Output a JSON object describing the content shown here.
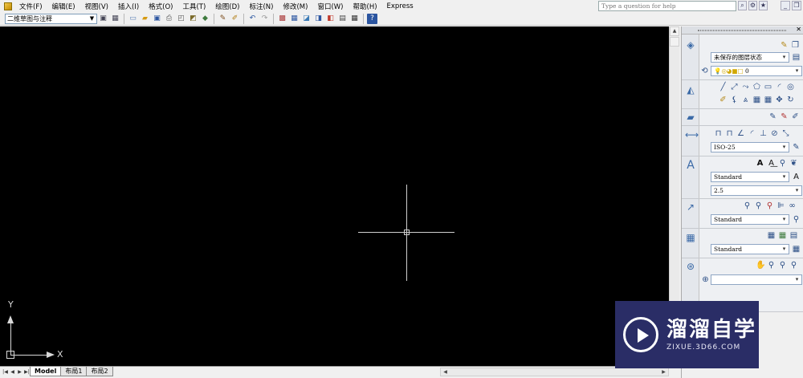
{
  "menubar": {
    "items": [
      "文件(F)",
      "编辑(E)",
      "视图(V)",
      "插入(I)",
      "格式(O)",
      "工具(T)",
      "绘图(D)",
      "标注(N)",
      "修改(M)",
      "窗口(W)",
      "帮助(H)",
      "Express"
    ],
    "help_placeholder": "Type a question for help"
  },
  "toolbar": {
    "workspace_value": "二维草图与注释",
    "icons": [
      "workspace-settings-icon",
      "workspace-icon",
      "new-icon",
      "open-icon",
      "save-icon",
      "print-icon",
      "preview-icon",
      "publish-icon",
      "3d-dwf-icon",
      "cut-icon",
      "match-icon",
      "undo-icon",
      "redo-icon",
      "pan-icon",
      "zoom-icon",
      "properties-icon",
      "design-center-icon",
      "tool-palette-icon",
      "sheet-set-icon",
      "markup-icon",
      "calc-icon",
      "help-icon"
    ]
  },
  "canvas": {
    "ucs_x_label": "X",
    "ucs_y_label": "Y"
  },
  "layout_tabs": [
    "Model",
    "布局1",
    "布局2"
  ],
  "dashboard": {
    "layer_state": "未保存的图层状态",
    "layer_current": "0",
    "dim_style": "ISO-25",
    "text_style": "Standard",
    "text_height": "2.5",
    "mleader_style": "Standard",
    "table_style": "Standard"
  },
  "watermark": {
    "title": "溜溜自学",
    "subtitle": "ZIXUE.3D66.COM"
  }
}
